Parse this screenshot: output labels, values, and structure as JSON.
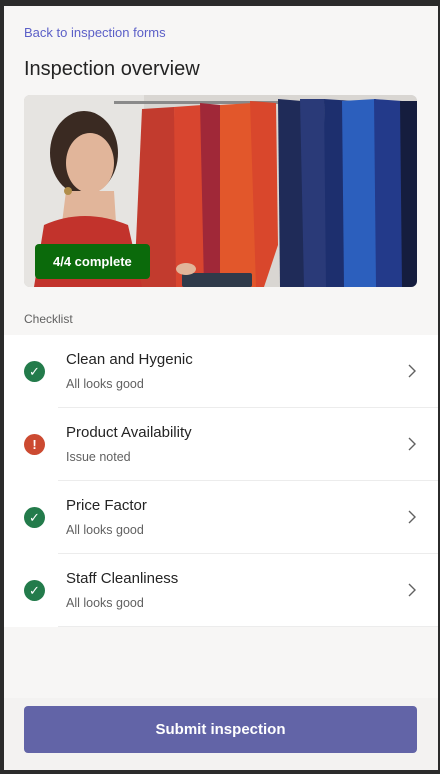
{
  "header": {
    "back_link": "Back to inspection forms",
    "title": "Inspection overview"
  },
  "hero": {
    "badge": "4/4 complete",
    "badge_color": "#0b6a0b"
  },
  "checklist": {
    "label": "Checklist",
    "items": [
      {
        "title": "Clean and Hygenic",
        "subtitle": "All looks good",
        "status": "ok",
        "icon": "check-circle-icon"
      },
      {
        "title": "Product Availability",
        "subtitle": "Issue noted",
        "status": "issue",
        "icon": "alert-circle-icon"
      },
      {
        "title": "Price Factor",
        "subtitle": "All looks good",
        "status": "ok",
        "icon": "check-circle-icon"
      },
      {
        "title": "Staff Cleanliness",
        "subtitle": "All looks good",
        "status": "ok",
        "icon": "check-circle-icon"
      }
    ]
  },
  "footer": {
    "submit_label": "Submit inspection",
    "accent": "#6264a7"
  }
}
